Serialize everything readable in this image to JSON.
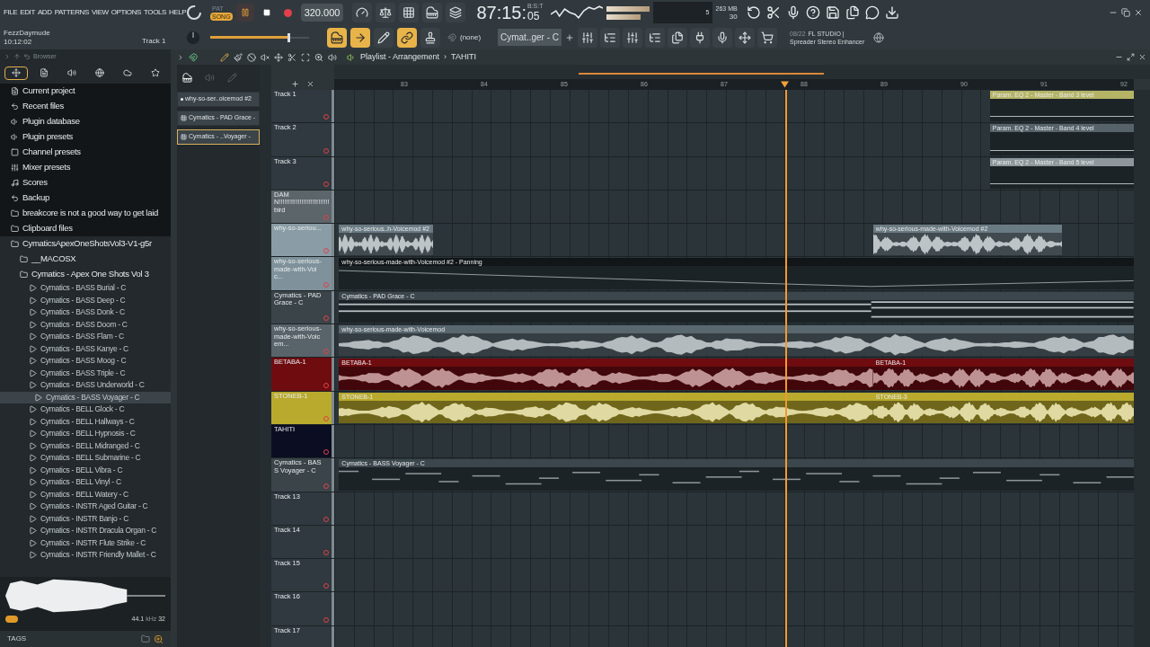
{
  "menu": [
    "FILE",
    "EDIT",
    "ADD",
    "PATTERNS",
    "VIEW",
    "OPTIONS",
    "TOOLS",
    "HELP"
  ],
  "transport": {
    "modes": [
      {
        "label": "PAT",
        "selected": false
      },
      {
        "label": "SONG",
        "selected": true
      }
    ],
    "playing": true,
    "tempo": "320.000"
  },
  "clock": {
    "time": "87:15:",
    "sub": "05",
    "unit": "B:S:T"
  },
  "cpu": {
    "voices": "5",
    "memory": "263 MB",
    "polyphony": "30"
  },
  "project": {
    "name": "FezzDaymude",
    "time": "10:12:02",
    "focus": "Track 1"
  },
  "master_volume": {
    "level": 0.78
  },
  "pattern_selector": {
    "channel": "(none)",
    "pattern": "Cymat..ger - C"
  },
  "hint": {
    "date": "08/22",
    "title": "FL STUDIO |",
    "text": "Spreader Stereo Enhancer"
  },
  "browser": {
    "title": "Browser",
    "tabs": [
      {
        "selected": true
      },
      {
        "selected": false
      },
      {
        "selected": false
      },
      {
        "selected": false
      },
      {
        "selected": false
      },
      {
        "selected": false
      }
    ],
    "items": [
      {
        "label": "Current project",
        "kind": "project",
        "selected": false
      },
      {
        "label": "Recent files",
        "kind": "recent",
        "selected": false
      },
      {
        "label": "Plugin database",
        "kind": "plugin",
        "selected": false
      },
      {
        "label": "Plugin presets",
        "kind": "plugin",
        "selected": false
      },
      {
        "label": "Channel presets",
        "kind": "channel",
        "selected": false
      },
      {
        "label": "Mixer presets",
        "kind": "mixer",
        "selected": false
      },
      {
        "label": "Scores",
        "kind": "scores",
        "selected": false
      },
      {
        "label": "Backup",
        "kind": "recent",
        "selected": false
      },
      {
        "label": "breakcore is not a good way to get laid",
        "kind": "folder",
        "selected": false
      },
      {
        "label": "Clipboard files",
        "kind": "folder",
        "selected": false
      },
      {
        "label": "CymaticsApexOneShotsVol3-V1-g5r",
        "kind": "folder",
        "selected": false,
        "children": [
          {
            "label": "__MACOSX",
            "kind": "folder",
            "selected": false
          },
          {
            "label": "Cymatics - Apex One Shots Vol 3",
            "kind": "folder",
            "selected": false,
            "children": [
              {
                "label": "Cymatics - BASS Burial - C",
                "kind": "file",
                "selected": false
              },
              {
                "label": "Cymatics - BASS Deep - C",
                "kind": "file",
                "selected": false
              },
              {
                "label": "Cymatics - BASS Donk - C",
                "kind": "file",
                "selected": false
              },
              {
                "label": "Cymatics - BASS Doom - C",
                "kind": "file",
                "selected": false
              },
              {
                "label": "Cymatics - BASS Flam - C",
                "kind": "file",
                "selected": false
              },
              {
                "label": "Cymatics - BASS Kanye - C",
                "kind": "file",
                "selected": false
              },
              {
                "label": "Cymatics - BASS Moog - C",
                "kind": "file",
                "selected": false
              },
              {
                "label": "Cymatics - BASS Triple - C",
                "kind": "file",
                "selected": false
              },
              {
                "label": "Cymatics - BASS Underworld - C",
                "kind": "file",
                "selected": false
              },
              {
                "label": "Cymatics - BASS Voyager - C",
                "kind": "file",
                "selected": true
              },
              {
                "label": "Cymatics - BELL Glock - C",
                "kind": "file",
                "selected": false
              },
              {
                "label": "Cymatics - BELL Hallways - C",
                "kind": "file",
                "selected": false
              },
              {
                "label": "Cymatics - BELL Hypnosis - C",
                "kind": "file",
                "selected": false
              },
              {
                "label": "Cymatics - BELL Midranged - C",
                "kind": "file",
                "selected": false
              },
              {
                "label": "Cymatics - BELL Submarine - C",
                "kind": "file",
                "selected": false
              },
              {
                "label": "Cymatics - BELL Vibra - C",
                "kind": "file",
                "selected": false
              },
              {
                "label": "Cymatics - BELL Vinyl - C",
                "kind": "file",
                "selected": false
              },
              {
                "label": "Cymatics - BELL Watery - C",
                "kind": "file",
                "selected": false
              },
              {
                "label": "Cymatics - INSTR Aged Guitar - C",
                "kind": "file",
                "selected": false
              },
              {
                "label": "Cymatics - INSTR Banjo - C",
                "kind": "file",
                "selected": false
              },
              {
                "label": "Cymatics - INSTR Dracula Organ - C",
                "kind": "file",
                "selected": false
              },
              {
                "label": "Cymatics - INSTR Flute Strike - C",
                "kind": "file",
                "selected": false
              },
              {
                "label": "Cymatics - INSTR Friendly Mallet - C",
                "kind": "file",
                "selected": false
              }
            ]
          }
        ]
      }
    ],
    "preview": {
      "rate": "44.1",
      "unit": "kHz",
      "bits": "32"
    },
    "tags": "TAGS"
  },
  "picker": [
    {
      "label": "why-so-ser..oicemod #2",
      "kind": "audio",
      "selected": false
    },
    {
      "label": "Cymatics - PAD Grace -",
      "kind": "pattern",
      "selected": false
    },
    {
      "label": "Cymatics - ..Voyager -",
      "kind": "pattern",
      "selected": true
    }
  ],
  "playlist": {
    "title": "Playlist - Arrangement",
    "separator": "›",
    "pattern": "TAHITI",
    "bars": [
      "83",
      "84",
      "85",
      "86",
      "87",
      "88",
      "89",
      "90",
      "91",
      "92"
    ],
    "playhead": {
      "level": 0.564
    }
  },
  "tracks": [
    {
      "name": "Track 1",
      "color": "#2f393f",
      "clips": [
        {
          "kind": "automation",
          "label": "Param. EQ 2 - Master - Band 3 level",
          "color": "#b5b466"
        }
      ]
    },
    {
      "name": "Track 2",
      "color": "#2f393f",
      "clips": [
        {
          "kind": "automation",
          "label": "Param. EQ 2 - Master - Band 4 level",
          "color": "#56636a"
        }
      ]
    },
    {
      "name": "Track 3",
      "color": "#2f393f",
      "clips": [
        {
          "kind": "automation",
          "label": "Param. EQ 2 - Master - Band 5 level",
          "color": "#8e979b"
        }
      ]
    },
    {
      "name": "DAMN!!!!!!!!!!!!!!!!!!!!!!!!!!! bird",
      "color": "#5b656a"
    },
    {
      "name": "why-so-seriou...",
      "color": "#8a9ca5",
      "clips": [
        {
          "kind": "audio",
          "label": "why-so-serious..h-Voicemod #2",
          "color": "#6b7b83"
        },
        {
          "kind": "audio",
          "label": "why-so-serious-made-with-Voicemod #2",
          "color": "#6b7b83"
        }
      ]
    },
    {
      "name": "why-so-serious-made-with-Voic...",
      "color": "#7f929b",
      "clips": [
        {
          "kind": "automation",
          "label": "why-so-serious-made-with-Voicemod #2 - Panning",
          "color": "#121618"
        }
      ]
    },
    {
      "name": "Cymatics - PAD Grace - C",
      "color": "#3a4449",
      "clips": [
        {
          "kind": "pattern",
          "label": "Cymatics - PAD Grace - C",
          "color": "#3c474d"
        }
      ]
    },
    {
      "name": "why-so-serious-made-with-Voicem...",
      "color": "#59646a",
      "clips": [
        {
          "kind": "audio",
          "label": "why-so-serious-made-with-Voicemod",
          "color": "#59676e"
        }
      ]
    },
    {
      "name": "BETABA-1",
      "color": "#6e0c10",
      "clips": [
        {
          "kind": "audio",
          "label": "BETABA-1",
          "color": "#6e0c10"
        },
        {
          "kind": "audio",
          "label": "BETABA-1",
          "color": "#6e0c10"
        }
      ]
    },
    {
      "name": "STONEB-1",
      "color": "#b9aa2e",
      "clips": [
        {
          "kind": "audio",
          "label": "STONEB-1",
          "color": "#b9aa2e"
        },
        {
          "kind": "audio",
          "label": "STONEB-3",
          "color": "#b9aa2e"
        }
      ]
    },
    {
      "name": "TAHITI",
      "color": "#0b0e22"
    },
    {
      "name": "Cymatics - BASS Voyager - C",
      "color": "#3a4449",
      "clips": [
        {
          "kind": "pattern",
          "label": "Cymatics - BASS Voyager - C",
          "color": "#3c474d"
        }
      ]
    },
    {
      "name": "Track 13",
      "color": "#2f393f"
    },
    {
      "name": "Track 14",
      "color": "#2f393f"
    },
    {
      "name": "Track 15",
      "color": "#2f393f"
    },
    {
      "name": "Track 16",
      "color": "#2f393f"
    },
    {
      "name": "Track 17",
      "color": "#2f393f"
    }
  ]
}
